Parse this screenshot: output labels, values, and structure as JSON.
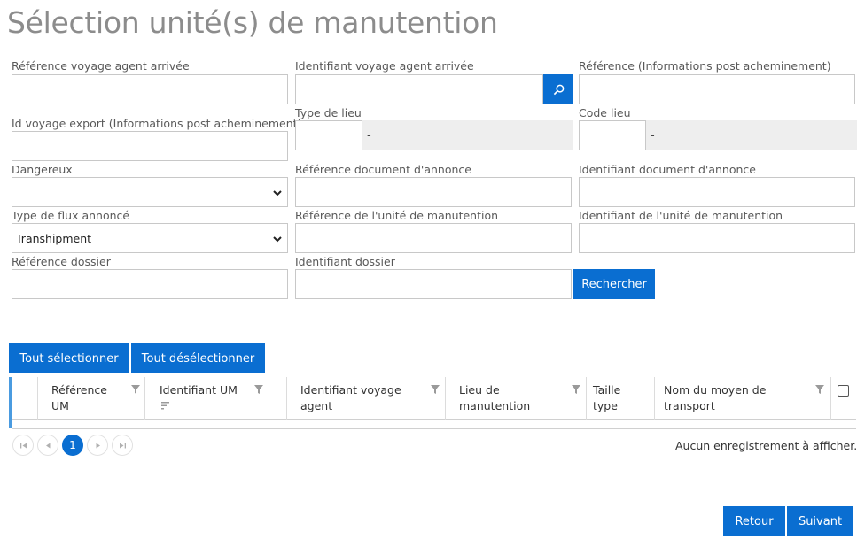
{
  "page": {
    "title": "Sélection unité(s) de manutention"
  },
  "form": {
    "ref_voyage_agent_arrivee": {
      "label": "Référence voyage agent arrivée",
      "value": ""
    },
    "id_voyage_agent_arrivee": {
      "label": "Identifiant voyage agent arrivée",
      "value": ""
    },
    "reference_post": {
      "label": "Référence (Informations post acheminement)",
      "value": ""
    },
    "id_voyage_export": {
      "label": "Id voyage export (Informations post acheminement)",
      "value": ""
    },
    "type_lieu": {
      "label": "Type de lieu",
      "value": "",
      "desc": "-"
    },
    "code_lieu": {
      "label": "Code lieu",
      "value": "",
      "desc": "-"
    },
    "dangereux": {
      "label": "Dangereux",
      "value": ""
    },
    "ref_document_annonce": {
      "label": "Référence document d'annonce",
      "value": ""
    },
    "id_document_annonce": {
      "label": "Identifiant document d'annonce",
      "value": ""
    },
    "type_flux": {
      "label": "Type de flux annoncé",
      "value": "Transhipment"
    },
    "ref_unite": {
      "label": "Référence de l'unité de manutention",
      "value": ""
    },
    "id_unite": {
      "label": "Identifiant de l'unité de manutention",
      "value": ""
    },
    "ref_dossier": {
      "label": "Référence dossier",
      "value": ""
    },
    "id_dossier": {
      "label": "Identifiant dossier",
      "value": ""
    },
    "search_label": "Rechercher"
  },
  "selection": {
    "select_all": "Tout sélectionner",
    "deselect_all": "Tout désélectionner"
  },
  "grid": {
    "columns": [
      {
        "l1": "Référence",
        "l2": "UM"
      },
      {
        "l1": "Identifiant UM",
        "l2": ""
      },
      {
        "l1": "Identifiant voyage",
        "l2": "agent"
      },
      {
        "l1": "Lieu de",
        "l2": "manutention"
      },
      {
        "l1": "Taille",
        "l2": "type"
      },
      {
        "l1": "Nom du moyen de",
        "l2": "transport"
      }
    ],
    "rows": []
  },
  "pager": {
    "current_page": "1",
    "status": "Aucun enregistrement à afficher."
  },
  "footer": {
    "back": "Retour",
    "next": "Suivant"
  },
  "colors": {
    "accent": "#0a6ed1",
    "title": "#8c8c8c"
  },
  "icons": {
    "search": "search-icon",
    "filter": "filter-icon",
    "chevron": "chevron-down-icon"
  }
}
